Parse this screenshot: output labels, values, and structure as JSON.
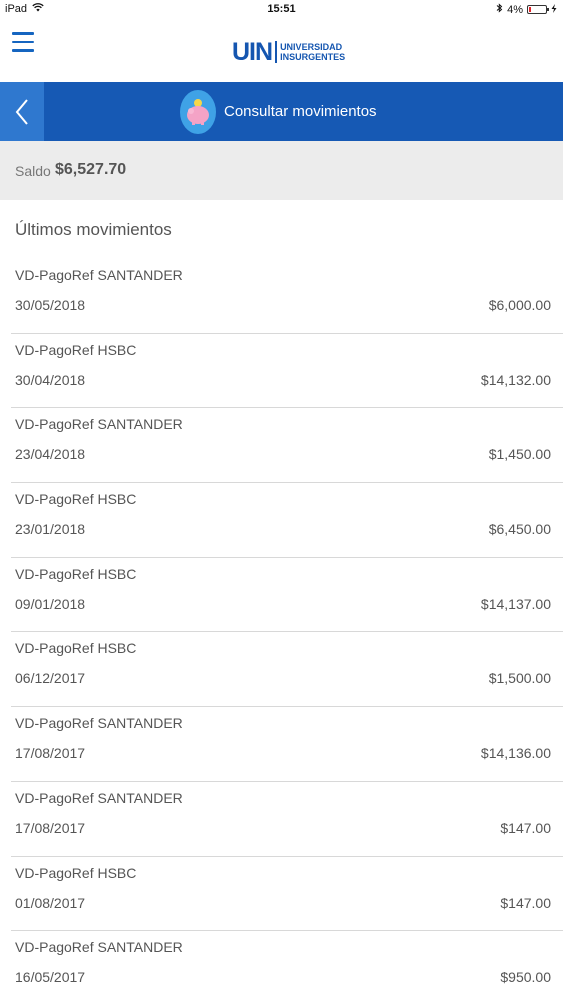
{
  "status_bar": {
    "device": "iPad",
    "time": "15:51",
    "battery": "4%"
  },
  "header": {
    "logo": {
      "short": "UIN",
      "line1": "UNIVERSIDAD",
      "line2": "INSURGENTES"
    }
  },
  "titlebar": {
    "title": "Consultar movimientos"
  },
  "balance": {
    "label": "Saldo",
    "value": "$6,527.70"
  },
  "movements": {
    "title": "Últimos movimientos",
    "items": [
      {
        "desc": "VD-PagoRef SANTANDER",
        "date": "30/05/2018",
        "amount": "$6,000.00"
      },
      {
        "desc": "VD-PagoRef HSBC",
        "date": "30/04/2018",
        "amount": "$14,132.00"
      },
      {
        "desc": "VD-PagoRef SANTANDER",
        "date": "23/04/2018",
        "amount": "$1,450.00"
      },
      {
        "desc": "VD-PagoRef HSBC",
        "date": "23/01/2018",
        "amount": "$6,450.00"
      },
      {
        "desc": "VD-PagoRef HSBC",
        "date": "09/01/2018",
        "amount": "$14,137.00"
      },
      {
        "desc": "VD-PagoRef HSBC",
        "date": "06/12/2017",
        "amount": "$1,500.00"
      },
      {
        "desc": "VD-PagoRef SANTANDER",
        "date": "17/08/2017",
        "amount": "$14,136.00"
      },
      {
        "desc": "VD-PagoRef SANTANDER",
        "date": "17/08/2017",
        "amount": "$147.00"
      },
      {
        "desc": "VD-PagoRef HSBC",
        "date": "01/08/2017",
        "amount": "$147.00"
      },
      {
        "desc": "VD-PagoRef SANTANDER",
        "date": "16/05/2017",
        "amount": "$950.00"
      }
    ]
  },
  "colors": {
    "brand_blue": "#1659b4",
    "back_button": "#2f78cf",
    "balance_bg": "#ececec"
  }
}
